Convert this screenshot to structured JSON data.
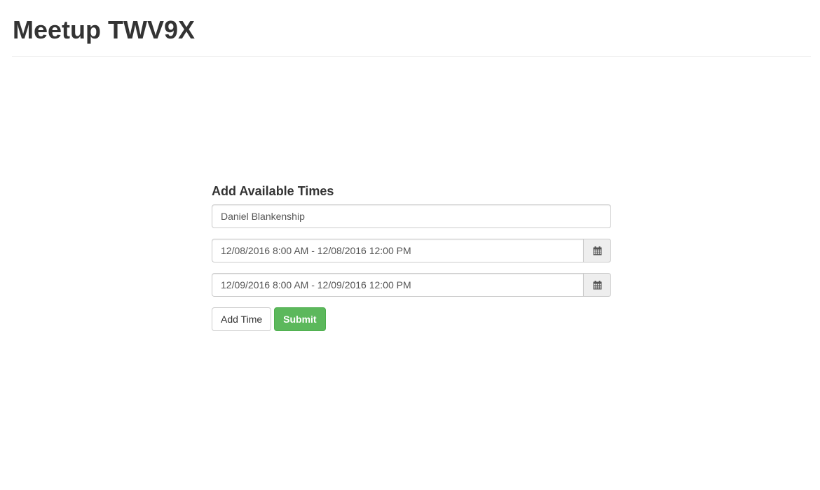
{
  "header": {
    "title": "Meetup TWV9X"
  },
  "form": {
    "heading": "Add Available Times",
    "name_value": "Daniel Blankenship",
    "time_ranges": [
      {
        "value": "12/08/2016 8:00 AM - 12/08/2016 12:00 PM",
        "icon": "calendar-icon"
      },
      {
        "value": "12/09/2016 8:00 AM - 12/09/2016 12:00 PM",
        "icon": "calendar-icon"
      }
    ],
    "add_time_label": "Add Time",
    "submit_label": "Submit"
  },
  "colors": {
    "success": "#5cb85c",
    "addon_bg": "#eeeeee",
    "border": "#cccccc"
  }
}
